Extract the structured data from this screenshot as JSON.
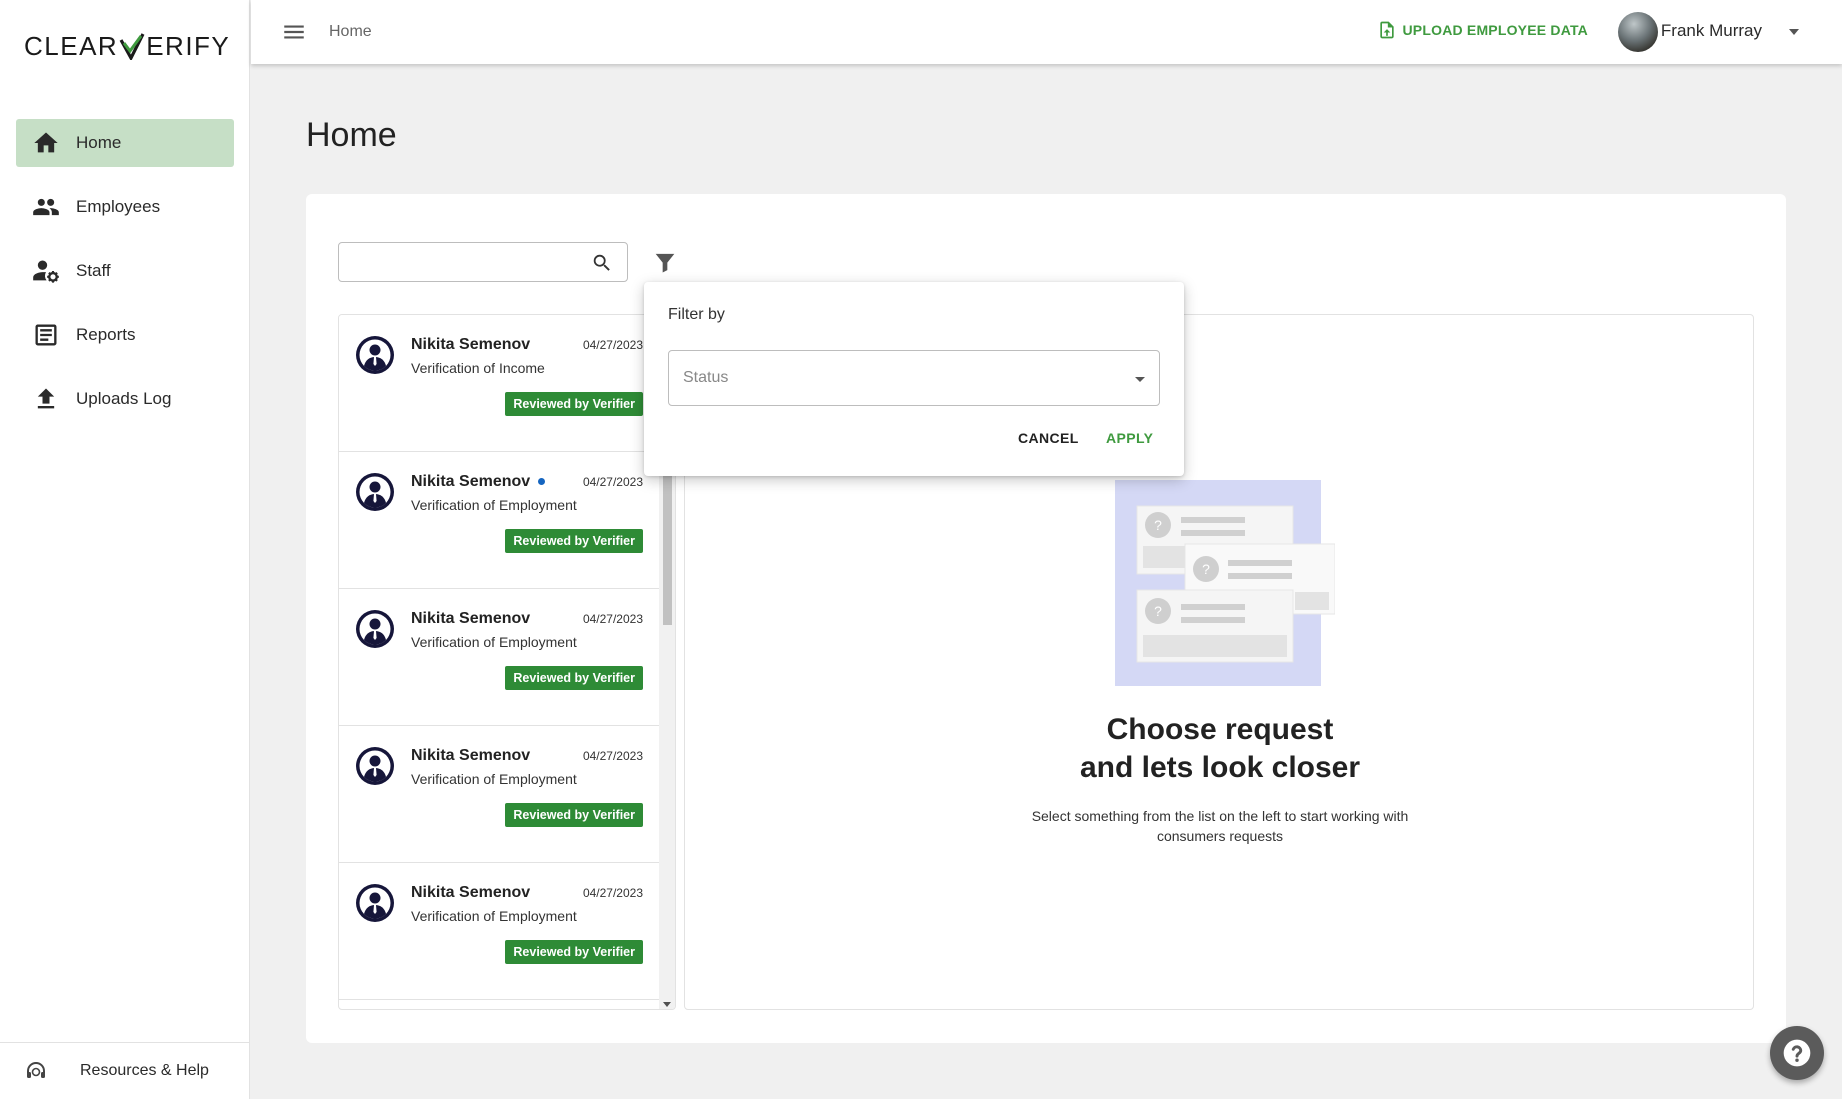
{
  "brand": {
    "logo_left": "CLEAR",
    "logo_right": "ERIFY"
  },
  "sidebar": {
    "items": [
      {
        "label": "Home",
        "icon": "home-icon",
        "active": true
      },
      {
        "label": "Employees",
        "icon": "people-icon",
        "active": false
      },
      {
        "label": "Staff",
        "icon": "staff-settings-icon",
        "active": false
      },
      {
        "label": "Reports",
        "icon": "reports-icon",
        "active": false
      },
      {
        "label": "Uploads Log",
        "icon": "upload-icon",
        "active": false
      }
    ],
    "help_label": "Resources & Help"
  },
  "header": {
    "breadcrumb": "Home",
    "upload_label": "UPLOAD EMPLOYEE DATA",
    "user_name": "Frank Murray"
  },
  "main": {
    "title": "Home",
    "search": {
      "value": "",
      "placeholder": ""
    },
    "requests": [
      {
        "name": "Nikita Semenov",
        "date": "04/27/2023",
        "type": "Verification of Income",
        "status": "Reviewed by Verifier",
        "unread": false
      },
      {
        "name": "Nikita Semenov",
        "date": "04/27/2023",
        "type": "Verification of Employment",
        "status": "Reviewed by Verifier",
        "unread": true
      },
      {
        "name": "Nikita Semenov",
        "date": "04/27/2023",
        "type": "Verification of Employment",
        "status": "Reviewed by Verifier",
        "unread": false
      },
      {
        "name": "Nikita Semenov",
        "date": "04/27/2023",
        "type": "Verification of Employment",
        "status": "Reviewed by Verifier",
        "unread": false
      },
      {
        "name": "Nikita Semenov",
        "date": "04/27/2023",
        "type": "Verification of Employment",
        "status": "Reviewed by Verifier",
        "unread": false
      }
    ],
    "empty_state": {
      "title_line1": "Choose request",
      "title_line2": "and lets look closer",
      "subtitle": "Select something from the list on the left to start working with consumers requests"
    }
  },
  "filter_popover": {
    "label": "Filter by",
    "select_placeholder": "Status",
    "cancel_label": "CANCEL",
    "apply_label": "APPLY"
  },
  "colors": {
    "accent": "#3f9a3f",
    "badge": "#2e8b36",
    "nav_active": "#c6dfc6",
    "unread_dot": "#1565c0"
  }
}
